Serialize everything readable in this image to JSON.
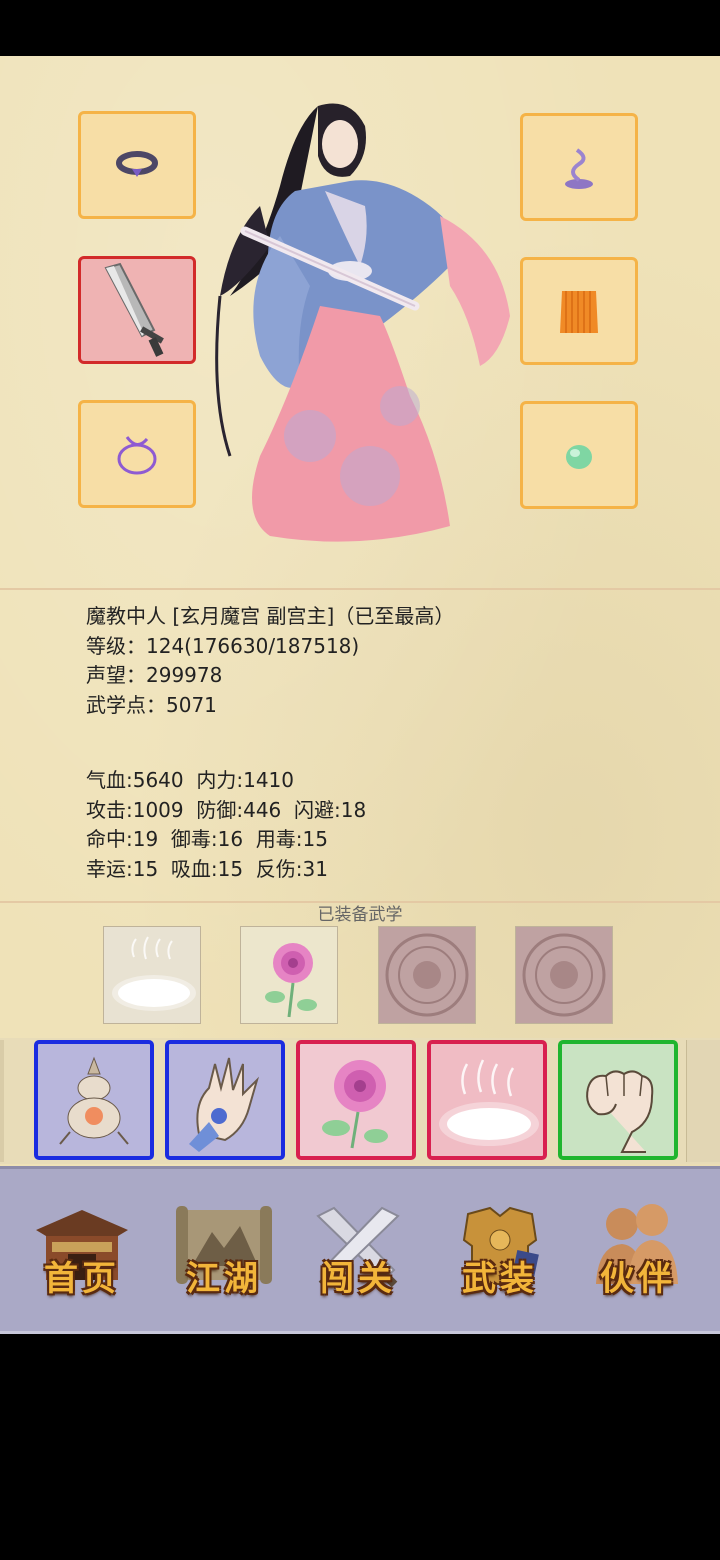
{
  "character": {
    "title_line": "魔教中人 [玄月魔宫 副宫主]（已至最高）",
    "level_line": "等级：124(176630/187518)",
    "fame_line": "声望：299978",
    "martial_points_line": "武学点：5071"
  },
  "stats": {
    "row1": "气血:5640  内力:1410",
    "row2": "攻击:1009  防御:446  闪避:18",
    "row3": "命中:19  御毒:16  用毒:15",
    "row4": "幸运:15  吸血:15  反伤:31"
  },
  "equipped_skills_label": "已装备武学",
  "equipment_slots": [
    {
      "icon": "ring-icon",
      "frame": "orange"
    },
    {
      "icon": "broadsword-icon",
      "frame": "red"
    },
    {
      "icon": "bracelet-icon",
      "frame": "orange"
    },
    {
      "icon": "incense-icon",
      "frame": "orange"
    },
    {
      "icon": "robe-icon",
      "frame": "orange"
    },
    {
      "icon": "jade-orb-icon",
      "frame": "orange"
    }
  ],
  "equipped_skills": [
    {
      "icon": "mist-icon"
    },
    {
      "icon": "rose-icon"
    },
    {
      "icon": "locked-seal-icon"
    },
    {
      "icon": "locked-seal-icon"
    }
  ],
  "skill_bar": [
    {
      "icon": "gourd-lamp-icon",
      "frame": "#1a2ce0"
    },
    {
      "icon": "open-palm-icon",
      "frame": "#1a2ce0"
    },
    {
      "icon": "rose-icon",
      "frame": "#d8204f"
    },
    {
      "icon": "mist-icon",
      "frame": "#d8204f"
    },
    {
      "icon": "fist-icon",
      "frame": "#1fb52f"
    }
  ],
  "nav": [
    {
      "label": "首页",
      "icon": "temple-icon"
    },
    {
      "label": "江湖",
      "icon": "scroll-map-icon"
    },
    {
      "label": "闯关",
      "icon": "crossed-swords-icon"
    },
    {
      "label": "武装",
      "icon": "armor-icon"
    },
    {
      "label": "伙伴",
      "icon": "companions-icon"
    }
  ],
  "colors": {
    "parchment": "#efe2b8",
    "slot_border": "#f5b347",
    "slot_selected_border": "#d22a2a",
    "nav_bg": "#aaa9c6",
    "nav_text": "#f2b53a"
  }
}
